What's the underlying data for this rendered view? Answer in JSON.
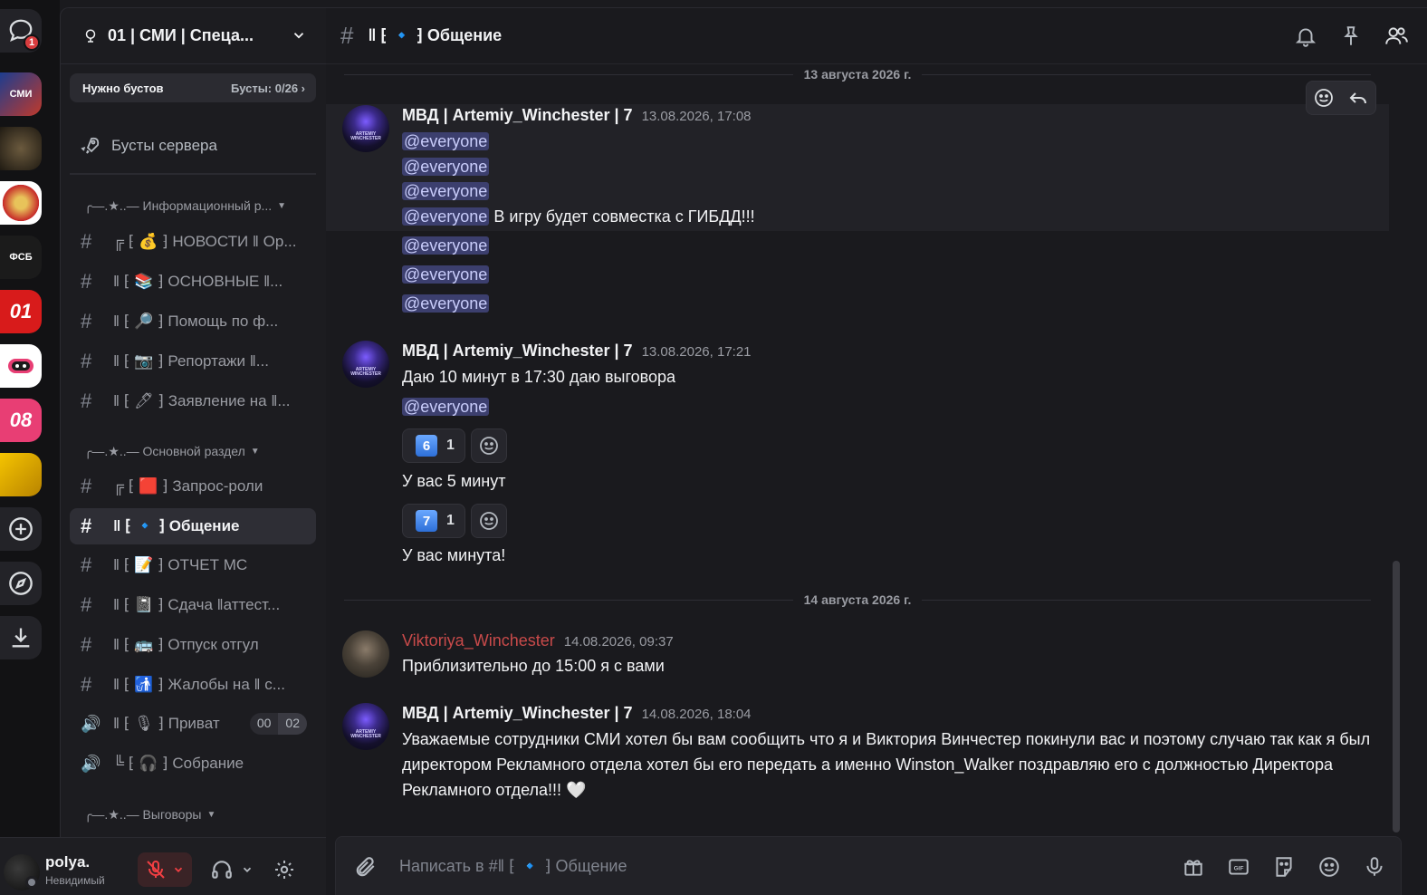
{
  "rail": {
    "dm_badge": "1",
    "servers": [
      {
        "label": "СМИ",
        "color": "#c0392b"
      },
      {
        "label": "",
        "color": "#3b2f22"
      },
      {
        "label": "",
        "color": "#c62828"
      },
      {
        "label": "ФСБ",
        "color": "#1b1b1b"
      },
      {
        "label": "01",
        "color": "#d81b1b"
      },
      {
        "label": "",
        "color": "#ffffff"
      },
      {
        "label": "08",
        "color": "#e83e74"
      },
      {
        "label": "",
        "color": "#e6a700"
      }
    ]
  },
  "server": {
    "name": "01 | СМИ | Спеца...",
    "boost_label": "Нужно бустов",
    "boost_count": "Бусты: 0/26 ›",
    "boosts_link": "Бусты сервера"
  },
  "categories": [
    {
      "label": "╭—.★..— Информационный р..."
    },
    {
      "label": "╭—.★..— Основной раздел"
    },
    {
      "label": "╭—.★..— Выговоры"
    }
  ],
  "channels": [
    {
      "prefix": "#",
      "name": "╔ ⁅ 💰 ⁆ НОВОСТИ ‖ Ор..."
    },
    {
      "prefix": "#",
      "name": "‖ ⁅ 📚 ⁆ ОСНОВНЫЕ ‖..."
    },
    {
      "prefix": "#",
      "name": "‖ ⁅ 🔎 ⁆ Помощь по ф..."
    },
    {
      "prefix": "#",
      "name": "‖ ⁅ 📷 ⁆ Репортажи ‖..."
    },
    {
      "prefix": "#",
      "name": "‖ ⁅ 🖊 ⁆ Заявление на ‖..."
    },
    {
      "prefix": "#",
      "name": "╔ ⁅ 🟥 ⁆ Запрос-роли"
    },
    {
      "prefix": "#",
      "name": "‖ ⁅ 🔹 ⁆ Общение"
    },
    {
      "prefix": "#",
      "name": "‖ ⁅ 📝 ⁆ ОТЧЕТ МС"
    },
    {
      "prefix": "#",
      "name": "‖ ⁅ 📓 ⁆ Сдача ‖аттест..."
    },
    {
      "prefix": "#",
      "name": "‖ ⁅ 🚌 ⁆ Отпуск отгул"
    },
    {
      "prefix": "#",
      "name": "‖ ⁅ 🚮 ⁆ Жалобы на ‖ с..."
    },
    {
      "prefix": "🔊",
      "name": "‖ ⁅ 🎙 ⁆ Приват",
      "count_a": "00",
      "count_b": "02"
    },
    {
      "prefix": "🔊",
      "name": "╚ ⁅ 🎧 ⁆ Собрание"
    }
  ],
  "user": {
    "name": "polya.",
    "status": "Невидимый"
  },
  "channel_header": {
    "title": "‖ ⁅ 🔹 ⁆ Общение"
  },
  "dividers": [
    "13 августа 2026 г.",
    "14 августа 2026 г."
  ],
  "messages": [
    {
      "author": "МВД | Artemiy_Winchester | 7",
      "time": "13.08.2026, 17:08",
      "mention": "@everyone",
      "text_after_mention": "В игру будет совместка с ГИБДД!!!"
    },
    {
      "author": "МВД | Artemiy_Winchester | 7",
      "time": "13.08.2026, 17:21",
      "text": "Даю 10 минут в 17:30 даю выговора",
      "mention": "@everyone",
      "reaction1_key": "6",
      "reaction1_count": "1",
      "line2": "У вас 5 минут",
      "reaction2_key": "7",
      "reaction2_count": "1",
      "line3": "У вас минута!"
    },
    {
      "author": "Viktoriya_Winchester",
      "time": "14.08.2026, 09:37",
      "text": "Приблизительно до 15:00 я с вами"
    },
    {
      "author": "МВД | Artemiy_Winchester | 7",
      "time": "14.08.2026, 18:04",
      "text": "Уважаемые сотрудники СМИ хотел бы вам сообщить что я и Виктория Винчестер покинули вас и поэтому случаю так как я был директором Рекламного отдела хотел бы его передать а именно Winston_Walker поздравляю его с должностью Директора Рекламного отдела!!! 🤍"
    }
  ],
  "composer": {
    "placeholder": "Написать в #‖ ⁅ 🔹 ⁆ Общение"
  }
}
